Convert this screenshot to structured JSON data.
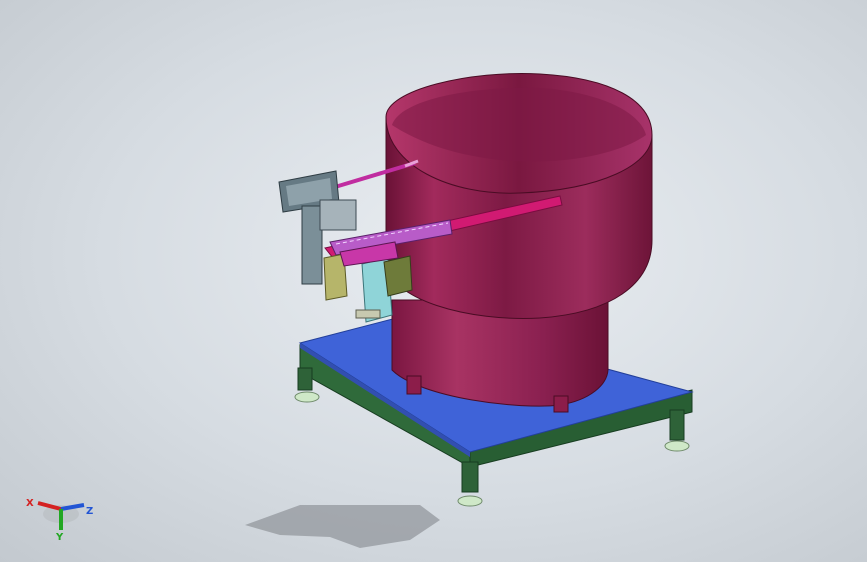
{
  "viewport": {
    "background": "#d6dce2",
    "model": {
      "bowl_color": "#8c1d4a",
      "bowl_highlight": "#b0386a",
      "track_color": "#d11a72",
      "plate_color": "#3f63d8",
      "frame_color": "#2f6a3a",
      "feet_color": "#cfe8c8",
      "shadow_color": "#8a8f95"
    }
  },
  "triad": {
    "x_label": "X",
    "y_label": "Y",
    "z_label": "Z",
    "x_color": "#d42222",
    "y_color": "#22a722",
    "z_color": "#2255d4"
  }
}
